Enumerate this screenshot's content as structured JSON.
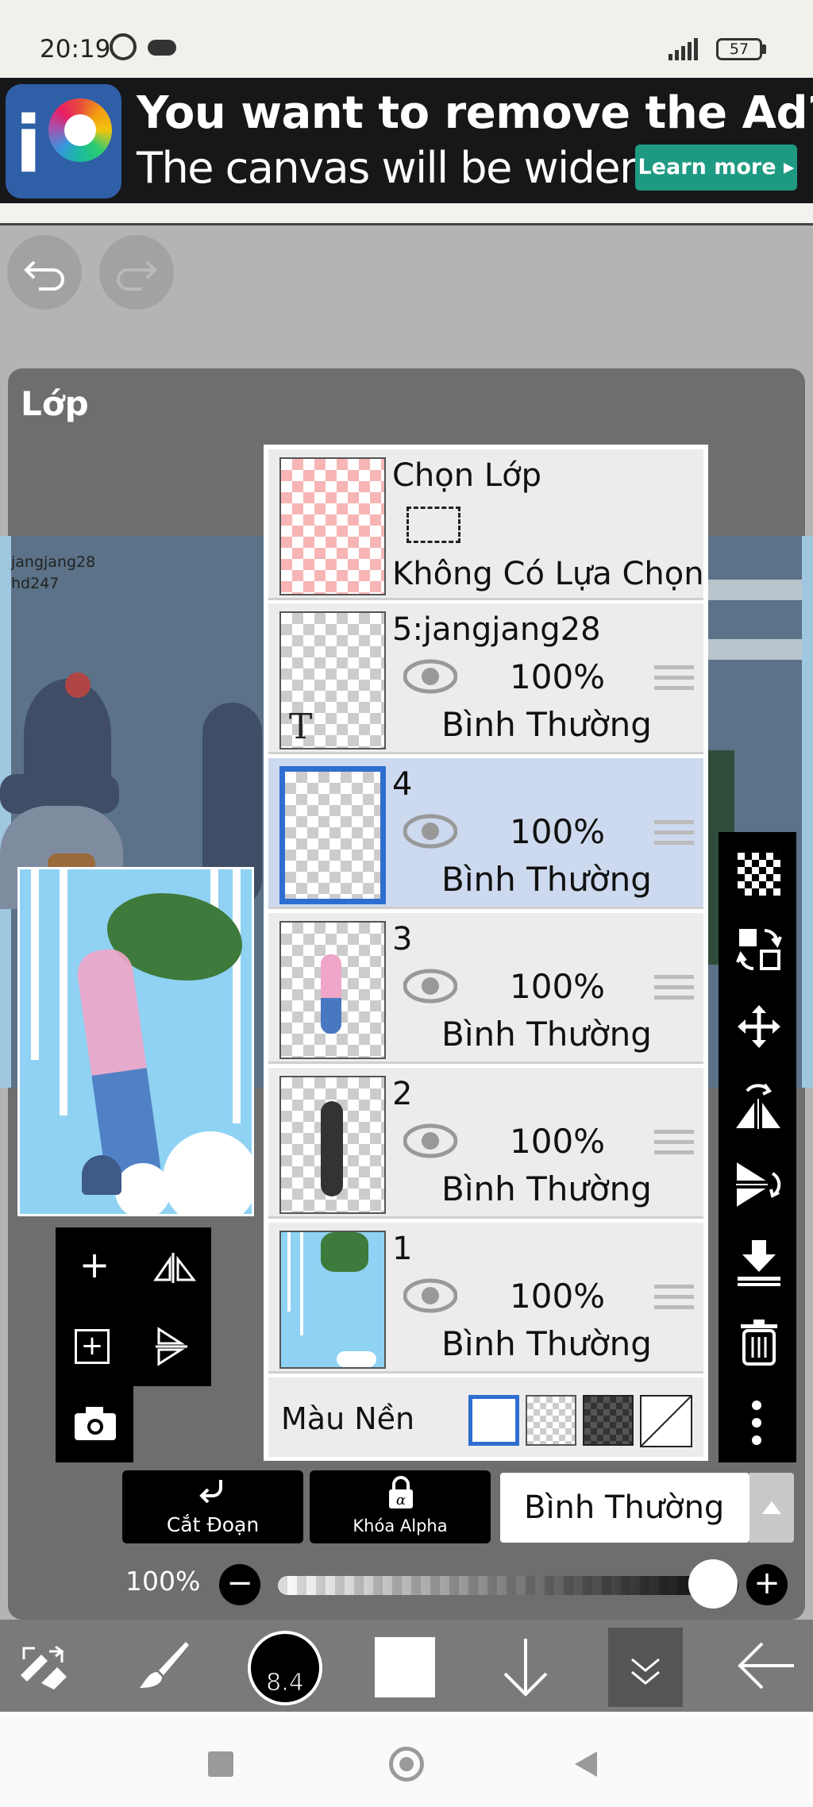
{
  "status_bar": {
    "time": "20:19",
    "battery": "57"
  },
  "ad": {
    "title": "You want to remove the Ad?",
    "subtitle": "The canvas will be wider.",
    "button": "Learn more ▸"
  },
  "panel": {
    "title": "Lớp"
  },
  "canvas_text": {
    "line1": "jangjang28",
    "line2": "hd247"
  },
  "selection_row": {
    "title": "Chọn Lớp",
    "subtitle": "Không Có Lựa Chọn"
  },
  "layers": [
    {
      "name": "5:jangjang28",
      "opacity": "100%",
      "blend": "Bình Thường"
    },
    {
      "name": "4",
      "opacity": "100%",
      "blend": "Bình Thường"
    },
    {
      "name": "3",
      "opacity": "100%",
      "blend": "Bình Thường"
    },
    {
      "name": "2",
      "opacity": "100%",
      "blend": "Bình Thường"
    },
    {
      "name": "1",
      "opacity": "100%",
      "blend": "Bình Thường"
    }
  ],
  "background_row": {
    "label": "Màu Nền"
  },
  "controls": {
    "clip": "Cắt Đoạn",
    "alpha_lock": "Khóa Alpha",
    "blend_mode": "Bình Thường",
    "opacity": "100%"
  },
  "toolbar": {
    "brush_size": "8.4"
  },
  "colors": {
    "ad_button": "#1e9a82",
    "selected_row": "#cdd9ee",
    "selection_border": "#2e6ed0"
  },
  "icons": [
    "alarm-icon",
    "cloud-icon",
    "signal-icon",
    "battery-icon",
    "undo-icon",
    "redo-icon",
    "eye-icon",
    "drag-handle-icon",
    "transparency-icon",
    "transfer-icon",
    "move-icon",
    "flip-horizontal-icon",
    "flip-vertical-icon",
    "merge-down-icon",
    "trash-icon",
    "more-icon",
    "add-layer-icon",
    "copy-layer-icon",
    "camera-icon",
    "clip-icon",
    "lock-icon",
    "transform-tool-icon",
    "brush-icon",
    "color-circle-icon",
    "down-arrow-icon",
    "collapse-icon",
    "back-arrow-icon",
    "stop-icon",
    "home-icon",
    "back-icon"
  ]
}
